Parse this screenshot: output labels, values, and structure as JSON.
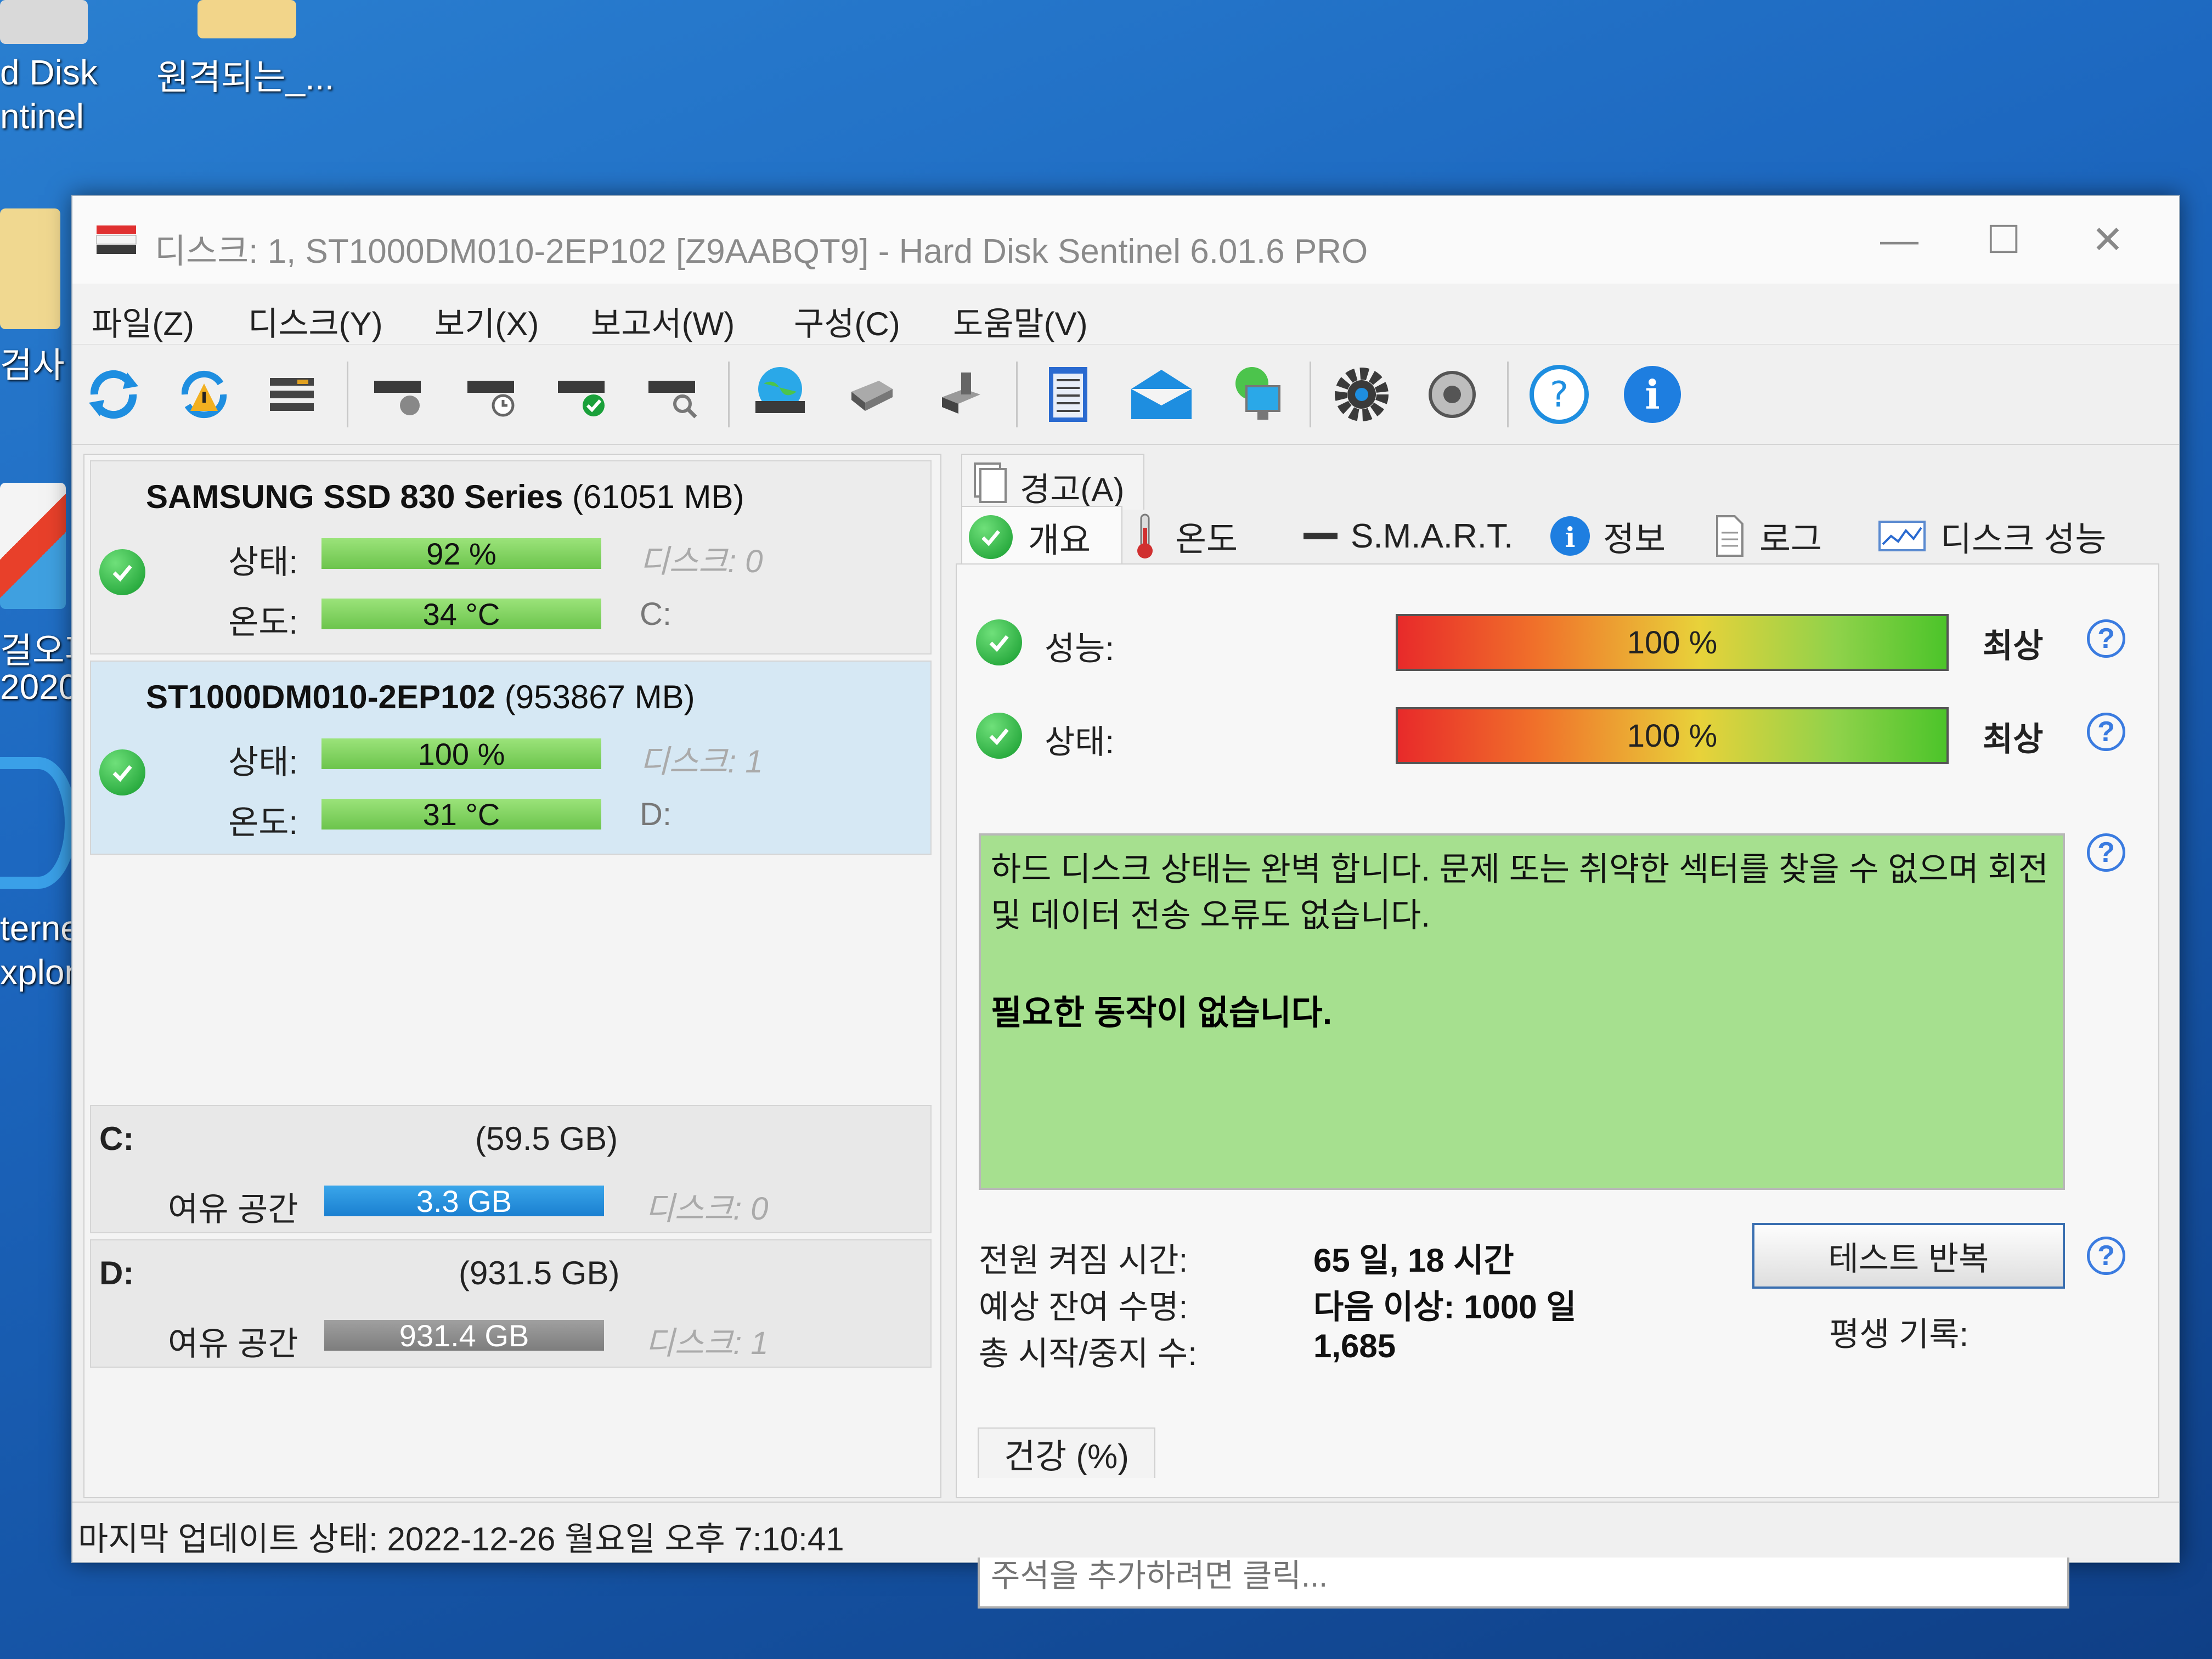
{
  "desktop": {
    "icon1_label_l1": "d Disk",
    "icon1_label_l2": "ntinel",
    "icon2_label": "원격되는_...",
    "icon3_label": "검사",
    "icon4_label_l1": "걸오피",
    "icon4_label_l2": "2020",
    "icon5_label_l1": "terne",
    "icon5_label_l2": "xplore"
  },
  "window": {
    "title": "디스크: 1, ST1000DM010-2EP102 [Z9AABQT9]  -  Hard Disk Sentinel 6.01.6 PRO",
    "minimize": "—",
    "maximize": "☐",
    "close": "✕"
  },
  "menu": {
    "file": "파일(Z)",
    "disk": "디스크(Y)",
    "view": "보기(X)",
    "report": "보고서(W)",
    "config": "구성(C)",
    "help": "도움말(V)"
  },
  "disks": [
    {
      "name": "SAMSUNG SSD 830 Series",
      "size": "(61051 MB)",
      "status_label": "상태:",
      "status_value": "92 %",
      "status_pct": 92,
      "temp_label": "온도:",
      "temp_value": "34 °C",
      "disk_tag": "디스크: 0",
      "drive": "C:"
    },
    {
      "name": "ST1000DM010-2EP102",
      "size": "(953867 MB)",
      "status_label": "상태:",
      "status_value": "100 %",
      "status_pct": 100,
      "temp_label": "온도:",
      "temp_value": "31 °C",
      "disk_tag": "디스크: 1",
      "drive": "D:"
    }
  ],
  "volumes": [
    {
      "letter": "C:",
      "size": "(59.5 GB)",
      "free_label": "여유 공간",
      "free_value": "3.3 GB",
      "disk_tag": "디스크: 0"
    },
    {
      "letter": "D:",
      "size": "(931.5 GB)",
      "free_label": "여유 공간",
      "free_value": "931.4 GB",
      "disk_tag": "디스크: 1"
    }
  ],
  "tabs": {
    "warning": "경고(A)",
    "overview": "개요",
    "temperature": "온도",
    "smart": "S.M.A.R.T.",
    "info": "정보",
    "log": "로그",
    "performance": "디스크 성능"
  },
  "overview": {
    "performance_label": "성능:",
    "performance_value": "100 %",
    "performance_rating": "최상",
    "health_label": "상태:",
    "health_value": "100 %",
    "health_rating": "최상",
    "status_text": "하드 디스크 상태는 완벽 합니다. 문제 또는 취약한 섹터를 찾을 수 없으며 회전 및 데이터 전송 오류도 없습니다.",
    "status_action": "필요한 동작이 없습니다.",
    "power_on_label": "전원 켜짐 시간:",
    "power_on_value": "65 일, 18 시간",
    "lifetime_label": "예상 잔여 수명:",
    "lifetime_value": "다음 이상: 1000 일",
    "start_stop_label": "총 시작/중지 수:",
    "start_stop_value": "1,685",
    "repeat_test_button": "테스트 반복",
    "lifetime_record": "평생 기록:",
    "note_placeholder": "주석을 추가하려면 클릭...",
    "health_chart_tab": "건강 (%)"
  },
  "statusbar": {
    "text": "마지막 업데이트 상태: 2022-12-26 월요일 오후 7:10:41"
  },
  "colors": {
    "status_green": "#a6e08f",
    "bar_green": "#6cc44c",
    "free_blue": "#1a7fd0",
    "free_grey": "#7d7d7d",
    "accent_blue": "#3a7be0"
  }
}
